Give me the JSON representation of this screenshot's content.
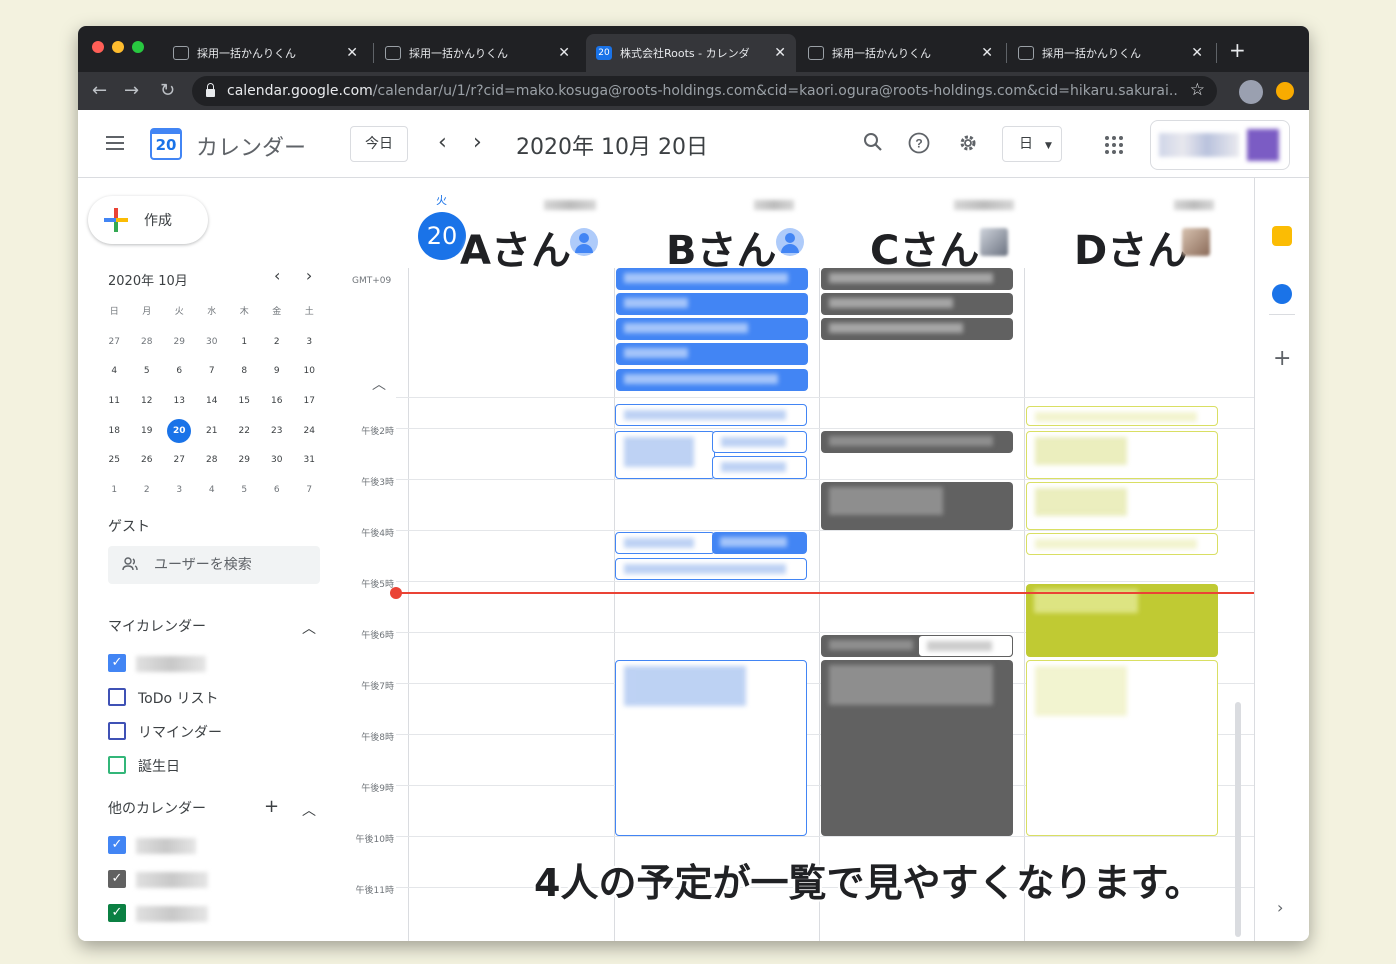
{
  "browser": {
    "tabs": [
      {
        "title": "採用一括かんりくん",
        "active": false
      },
      {
        "title": "採用一括かんりくん",
        "active": false
      },
      {
        "title": "株式会社Roots - カレンダ",
        "active": true
      },
      {
        "title": "採用一括かんりくん",
        "active": false
      },
      {
        "title": "採用一括かんりくん",
        "active": false
      }
    ],
    "url_domain": "calendar.google.com",
    "url_path": "/calendar/u/1/r?cid=mako.kosuga@roots-holdings.com&cid=kaori.ogura@roots-holdings.com&cid=hikaru.sakurai...",
    "favicon_date": "20"
  },
  "header": {
    "logo_date": "20",
    "app_name": "カレンダー",
    "today_label": "今日",
    "prev": "‹",
    "next": "›",
    "date_title": "2020年 10月 20日",
    "view_label": "日"
  },
  "sidebar": {
    "create_label": "作成",
    "mini_month": "2020年 10月",
    "weekdays": [
      "日",
      "月",
      "火",
      "水",
      "木",
      "金",
      "土"
    ],
    "weeks": [
      [
        "27",
        "28",
        "29",
        "30",
        "1",
        "2",
        "3"
      ],
      [
        "4",
        "5",
        "6",
        "7",
        "8",
        "9",
        "10"
      ],
      [
        "11",
        "12",
        "13",
        "14",
        "15",
        "16",
        "17"
      ],
      [
        "18",
        "19",
        "20",
        "21",
        "22",
        "23",
        "24"
      ],
      [
        "25",
        "26",
        "27",
        "28",
        "29",
        "30",
        "31"
      ],
      [
        "1",
        "2",
        "3",
        "4",
        "5",
        "6",
        "7"
      ]
    ],
    "today": "20",
    "guest_title": "ゲスト",
    "search_placeholder": "ユーザーを検索",
    "my_calendars_title": "マイカレンダー",
    "my_calendars": [
      {
        "label": "",
        "checked": true,
        "color": "#4285f4"
      },
      {
        "label": "ToDo リスト",
        "checked": false,
        "color": "#3f51b5"
      },
      {
        "label": "リマインダー",
        "checked": false,
        "color": "#3f51b5"
      },
      {
        "label": "誕生日",
        "checked": false,
        "color": "#33b679"
      }
    ],
    "other_calendars_title": "他のカレンダー",
    "other_calendars": [
      {
        "checked": true,
        "color": "#4285f4"
      },
      {
        "checked": true,
        "color": "#616161"
      },
      {
        "checked": true,
        "color": "#0b8043"
      }
    ]
  },
  "day": {
    "weekday": "火",
    "number": "20",
    "timezone": "GMT+09",
    "hours": [
      "午後2時",
      "午後3時",
      "午後4時",
      "午後5時",
      "午後6時",
      "午後7時",
      "午後8時",
      "午後9時",
      "午後10時",
      "午後11時"
    ],
    "people": [
      "Aさん",
      "Bさん",
      "Cさん",
      "Dさん"
    ]
  },
  "colors": {
    "B": "#4285f4",
    "C": "#616161",
    "D": "#c0ca33",
    "now": "#ea4335"
  },
  "caption": "4人の予定が一覧で見やすくなります。"
}
